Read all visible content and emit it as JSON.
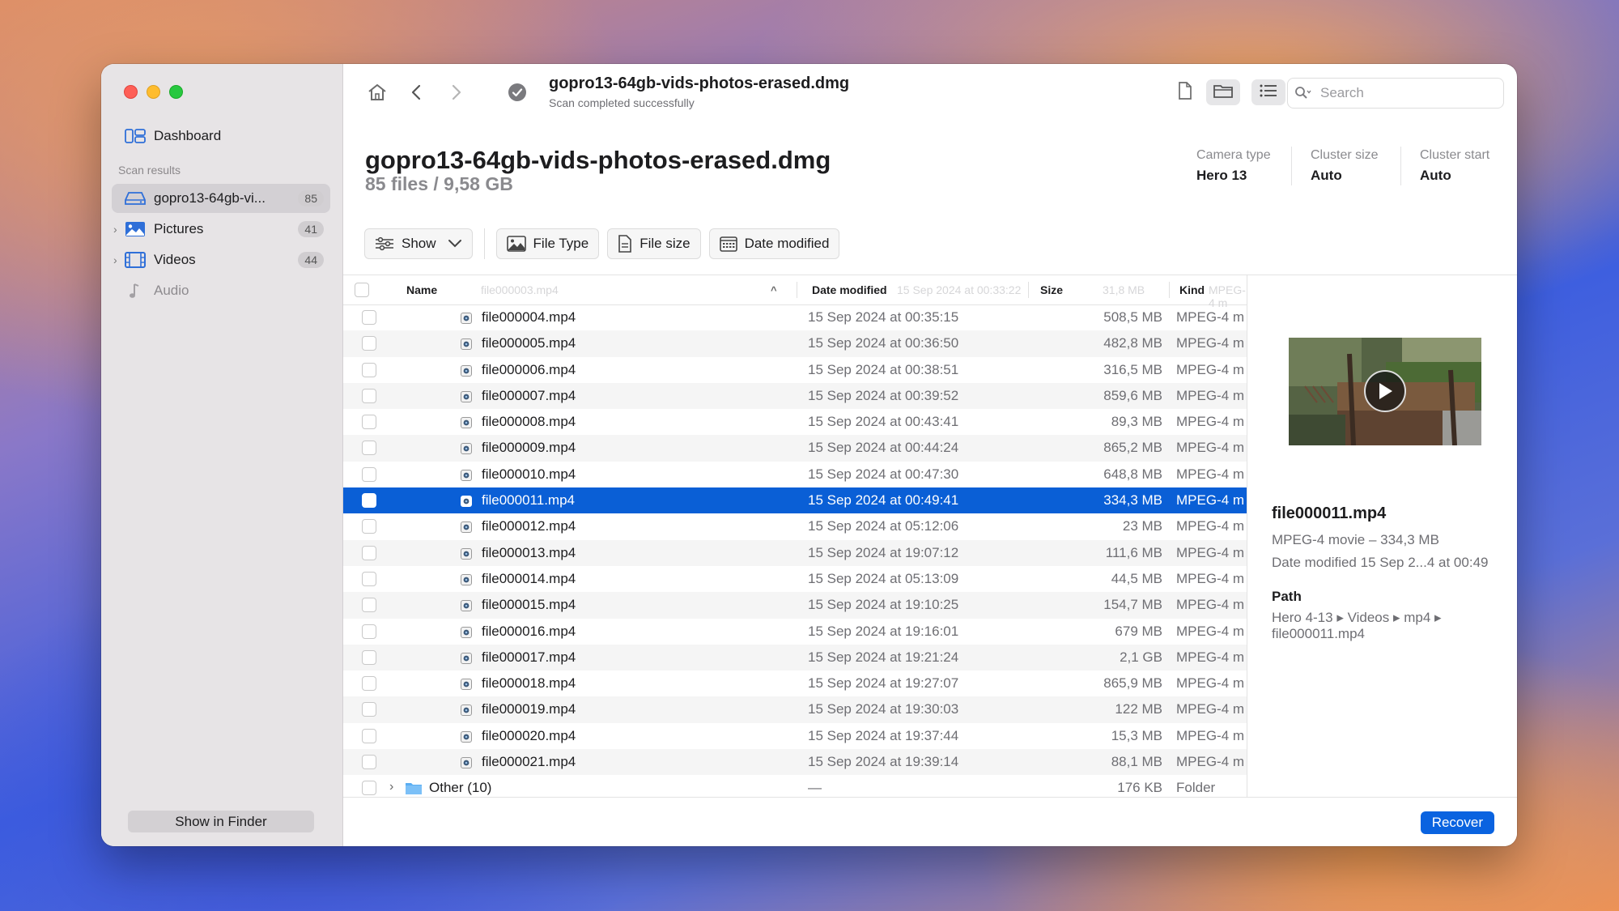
{
  "sidebar": {
    "dashboard_label": "Dashboard",
    "section_label": "Scan results",
    "items": [
      {
        "label": "gopro13-64gb-vi...",
        "count": "85"
      },
      {
        "label": "Pictures",
        "count": "41"
      },
      {
        "label": "Videos",
        "count": "44"
      },
      {
        "label": "Audio",
        "count": ""
      }
    ],
    "show_in_finder": "Show in Finder"
  },
  "toolbar": {
    "title": "gopro13-64gb-vids-photos-erased.dmg",
    "subtitle": "Scan completed successfully",
    "search_placeholder": "Search"
  },
  "header": {
    "title": "gopro13-64gb-vids-photos-erased.dmg",
    "summary": "85 files / 9,58 GB",
    "meta": [
      {
        "label": "Camera type",
        "value": "Hero 13"
      },
      {
        "label": "Cluster size",
        "value": "Auto"
      },
      {
        "label": "Cluster start",
        "value": "Auto"
      }
    ]
  },
  "filters": {
    "show": "Show",
    "file_type": "File Type",
    "file_size": "File size",
    "date_modified": "Date modified"
  },
  "table": {
    "columns": {
      "name": "Name",
      "date": "Date modified",
      "size": "Size",
      "kind": "Kind"
    },
    "ghost": {
      "name": "file000003.mp4",
      "date": "15 Sep 2024 at 00:33:22",
      "size": "31,8 MB",
      "kind": "MPEG-4 m"
    },
    "rows": [
      {
        "name": "file000004.mp4",
        "date": "15 Sep 2024 at 00:35:15",
        "size": "508,5 MB",
        "kind": "MPEG-4 m"
      },
      {
        "name": "file000005.mp4",
        "date": "15 Sep 2024 at 00:36:50",
        "size": "482,8 MB",
        "kind": "MPEG-4 m"
      },
      {
        "name": "file000006.mp4",
        "date": "15 Sep 2024 at 00:38:51",
        "size": "316,5 MB",
        "kind": "MPEG-4 m"
      },
      {
        "name": "file000007.mp4",
        "date": "15 Sep 2024 at 00:39:52",
        "size": "859,6 MB",
        "kind": "MPEG-4 m"
      },
      {
        "name": "file000008.mp4",
        "date": "15 Sep 2024 at 00:43:41",
        "size": "89,3 MB",
        "kind": "MPEG-4 m"
      },
      {
        "name": "file000009.mp4",
        "date": "15 Sep 2024 at 00:44:24",
        "size": "865,2 MB",
        "kind": "MPEG-4 m"
      },
      {
        "name": "file000010.mp4",
        "date": "15 Sep 2024 at 00:47:30",
        "size": "648,8 MB",
        "kind": "MPEG-4 m"
      },
      {
        "name": "file000011.mp4",
        "date": "15 Sep 2024 at 00:49:41",
        "size": "334,3 MB",
        "kind": "MPEG-4 m",
        "selected": true
      },
      {
        "name": "file000012.mp4",
        "date": "15 Sep 2024 at 05:12:06",
        "size": "23 MB",
        "kind": "MPEG-4 m"
      },
      {
        "name": "file000013.mp4",
        "date": "15 Sep 2024 at 19:07:12",
        "size": "111,6 MB",
        "kind": "MPEG-4 m"
      },
      {
        "name": "file000014.mp4",
        "date": "15 Sep 2024 at 05:13:09",
        "size": "44,5 MB",
        "kind": "MPEG-4 m"
      },
      {
        "name": "file000015.mp4",
        "date": "15 Sep 2024 at 19:10:25",
        "size": "154,7 MB",
        "kind": "MPEG-4 m"
      },
      {
        "name": "file000016.mp4",
        "date": "15 Sep 2024 at 19:16:01",
        "size": "679 MB",
        "kind": "MPEG-4 m"
      },
      {
        "name": "file000017.mp4",
        "date": "15 Sep 2024 at 19:21:24",
        "size": "2,1 GB",
        "kind": "MPEG-4 m"
      },
      {
        "name": "file000018.mp4",
        "date": "15 Sep 2024 at 19:27:07",
        "size": "865,9 MB",
        "kind": "MPEG-4 m"
      },
      {
        "name": "file000019.mp4",
        "date": "15 Sep 2024 at 19:30:03",
        "size": "122 MB",
        "kind": "MPEG-4 m"
      },
      {
        "name": "file000020.mp4",
        "date": "15 Sep 2024 at 19:37:44",
        "size": "15,3 MB",
        "kind": "MPEG-4 m"
      },
      {
        "name": "file000021.mp4",
        "date": "15 Sep 2024 at 19:39:14",
        "size": "88,1 MB",
        "kind": "MPEG-4 m"
      }
    ],
    "folder_row": {
      "name": "Other (10)",
      "date": "—",
      "size": "176 KB",
      "kind": "Folder"
    }
  },
  "preview": {
    "name": "file000011.mp4",
    "kind_size": "MPEG-4 movie – 334,3 MB",
    "date_label": "Date modified",
    "date_value": "15 Sep 2...4 at 00:49",
    "path_label": "Path",
    "path": "Hero 4-13 ▸ Videos ▸ mp4 ▸ file000011.mp4"
  },
  "footer": {
    "recover": "Recover"
  },
  "colors": {
    "accent": "#0a63e0",
    "selection": "#0a5fd6"
  }
}
